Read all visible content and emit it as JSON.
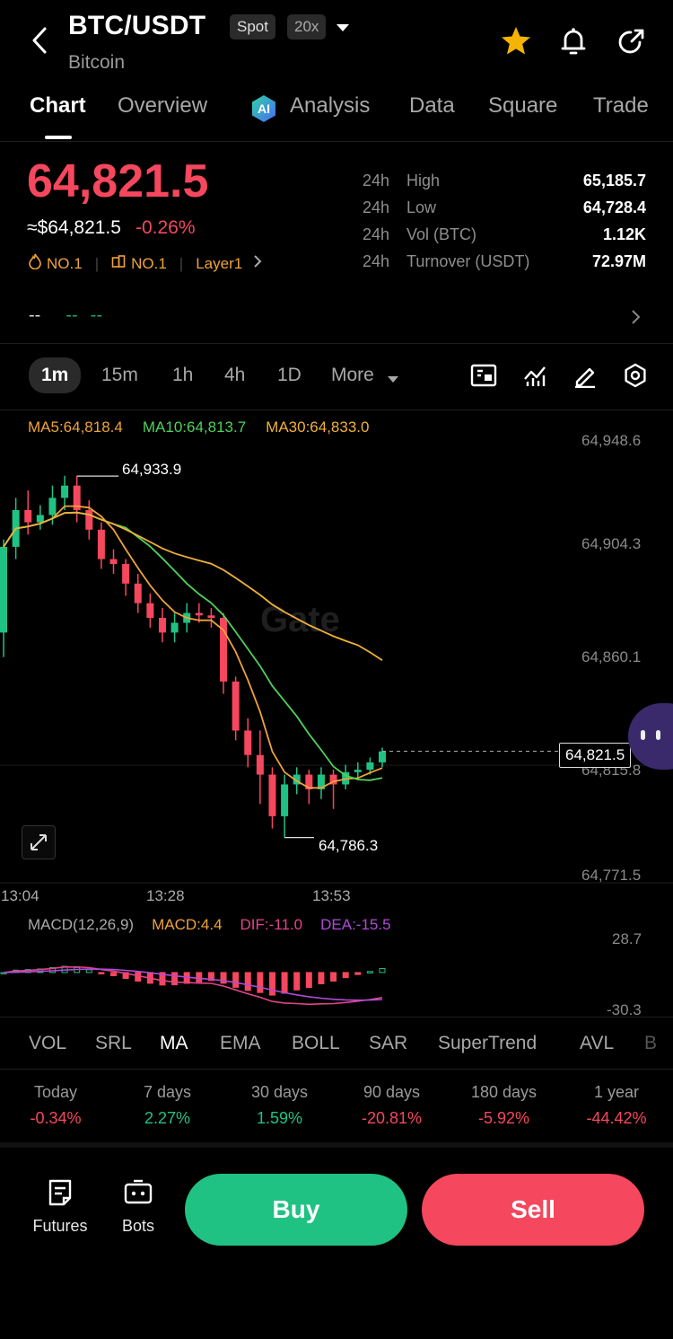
{
  "header": {
    "pair": "BTC/USDT",
    "market_tag": "Spot",
    "leverage_tag": "20x",
    "coin_name": "Bitcoin"
  },
  "tabs": [
    "Chart",
    "Overview",
    "Analysis",
    "Data",
    "Square",
    "Trade"
  ],
  "price": {
    "last": "64,821.5",
    "usd": "≈$64,821.5",
    "change": "-0.26%",
    "rank1": "NO.1",
    "rank2": "NO.1",
    "sector": "Layer1"
  },
  "stats": [
    {
      "period": "24h",
      "label": "High",
      "value": "65,185.7"
    },
    {
      "period": "24h",
      "label": "Low",
      "value": "64,728.4"
    },
    {
      "period": "24h",
      "label": "Vol (BTC)",
      "value": "1.12K"
    },
    {
      "period": "24h",
      "label": "Turnover (USDT)",
      "value": "72.97M"
    }
  ],
  "ticker_placeholder": {
    "a": "--",
    "b": "--",
    "c": "--"
  },
  "timeframes": [
    "1m",
    "15m",
    "1h",
    "4h",
    "1D",
    "More"
  ],
  "ma_legend": {
    "ma5": "MA5:64,818.4",
    "ma10": "MA10:64,813.7",
    "ma30": "MA30:64,833.0"
  },
  "chart": {
    "y_ticks": [
      "64,948.6",
      "64,904.3",
      "64,860.1",
      "64,815.8",
      "64,771.5"
    ],
    "high_label": "64,933.9",
    "low_label": "64,786.3",
    "current_price": "64,821.5",
    "x_ticks": [
      "13:04",
      "13:28",
      "13:53"
    ],
    "watermark": "Gate"
  },
  "macd": {
    "title": "MACD(12,26,9)",
    "macd": "MACD:4.4",
    "dif": "DIF:-11.0",
    "dea": "DEA:-15.5",
    "top": "28.7",
    "bottom": "-30.3"
  },
  "indicators": [
    "VOL",
    "SRL",
    "MA",
    "EMA",
    "BOLL",
    "SAR",
    "SuperTrend",
    "AVL",
    "B"
  ],
  "performance": [
    {
      "label": "Today",
      "value": "-0.34%"
    },
    {
      "label": "7 days",
      "value": "2.27%"
    },
    {
      "label": "30 days",
      "value": "1.59%"
    },
    {
      "label": "90 days",
      "value": "-20.81%"
    },
    {
      "label": "180 days",
      "value": "-5.92%"
    },
    {
      "label": "1 year",
      "value": "-44.42%"
    }
  ],
  "bottom": {
    "futures": "Futures",
    "bots": "Bots",
    "buy": "Buy",
    "sell": "Sell"
  },
  "colors": {
    "up": "#20c283",
    "down": "#f5475d",
    "ma5": "#f0a33a",
    "ma10": "#4fd15a",
    "ma30": "#f0b03a",
    "dif": "#e0448a",
    "dea": "#b04ad8"
  },
  "chart_data": {
    "type": "candlestick",
    "x_ticks": [
      "13:04",
      "13:28",
      "13:53"
    ],
    "ylim": [
      64771.5,
      64948.6
    ],
    "high": 64933.9,
    "low": 64786.3,
    "last": 64821.5,
    "ma5_last": 64818.4,
    "ma10_last": 64813.7,
    "ma30_last": 64833.0,
    "candles": [
      [
        64870,
        64905,
        64908,
        64860
      ],
      [
        64905,
        64920,
        64925,
        64900
      ],
      [
        64920,
        64915,
        64928,
        64910
      ],
      [
        64915,
        64918,
        64922,
        64912
      ],
      [
        64918,
        64925,
        64930,
        64914
      ],
      [
        64925,
        64930,
        64934,
        64920
      ],
      [
        64930,
        64920,
        64933.9,
        64915
      ],
      [
        64920,
        64912,
        64924,
        64908
      ],
      [
        64912,
        64900,
        64915,
        64896
      ],
      [
        64900,
        64898,
        64904,
        64894
      ],
      [
        64898,
        64890,
        64900,
        64885
      ],
      [
        64890,
        64882,
        64894,
        64878
      ],
      [
        64882,
        64876,
        64886,
        64872
      ],
      [
        64876,
        64870,
        64880,
        64866
      ],
      [
        64870,
        64874,
        64878,
        64866
      ],
      [
        64874,
        64878,
        64882,
        64870
      ],
      [
        64878,
        64877,
        64882,
        64874
      ],
      [
        64877,
        64876,
        64880,
        64872
      ],
      [
        64876,
        64850,
        64878,
        64845
      ],
      [
        64850,
        64830,
        64852,
        64826
      ],
      [
        64830,
        64820,
        64835,
        64815
      ],
      [
        64820,
        64812,
        64830,
        64800
      ],
      [
        64812,
        64795,
        64815,
        64790
      ],
      [
        64795,
        64808,
        64812,
        64786.3
      ],
      [
        64808,
        64812,
        64815,
        64804
      ],
      [
        64812,
        64806,
        64814,
        64800
      ],
      [
        64806,
        64812,
        64815,
        64802
      ],
      [
        64812,
        64808,
        64814,
        64798
      ],
      [
        64808,
        64813,
        64816,
        64806
      ],
      [
        64813,
        64814,
        64817,
        64810
      ],
      [
        64814,
        64817,
        64819,
        64812
      ],
      [
        64817,
        64821.5,
        64823,
        64815
      ]
    ],
    "macd_range": [
      -30.3,
      28.7
    ]
  }
}
